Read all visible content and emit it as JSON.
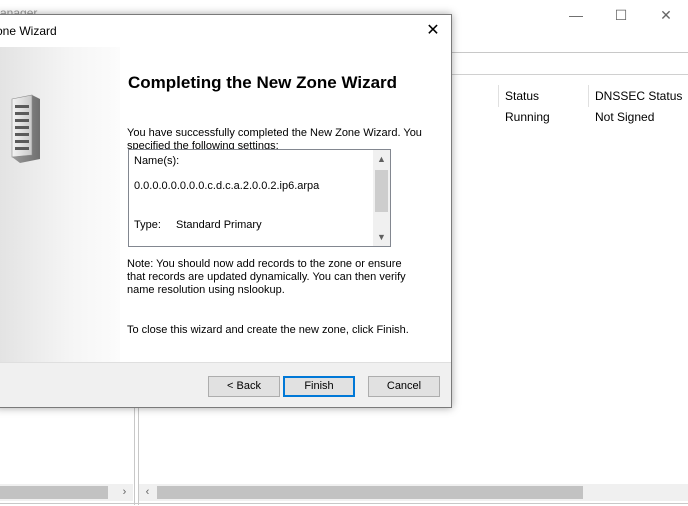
{
  "background_window": {
    "title": "Manager",
    "controls": {
      "minimize": "—",
      "maximize": "☐",
      "close": "✕"
    },
    "columns": [
      "Status",
      "DNSSEC Status"
    ],
    "row": {
      "status": "Running",
      "dnssec_status": "Not Signed"
    },
    "scroll_left": "‹",
    "scroll_right": "›"
  },
  "wizard": {
    "title": "one Wizard",
    "close_glyph": "✕",
    "heading": "Completing the New Zone Wizard",
    "intro": "You have successfully completed the New Zone Wizard. You specified the following settings:",
    "settings": {
      "names_label": "Name(s):",
      "zone_name": "0.0.0.0.0.0.0.0.c.d.c.a.2.0.0.2.ip6.arpa",
      "type_label": "Type:",
      "type_value": "Standard Primary",
      "scroll_up": "▲",
      "scroll_down": "▼"
    },
    "note": "Note: You should now add records to the zone or ensure that records are updated dynamically. You can then verify name resolution using nslookup.",
    "close_instruction": "To close this wizard and create the new zone, click Finish.",
    "buttons": {
      "back": "< Back",
      "finish": "Finish",
      "cancel": "Cancel"
    }
  }
}
